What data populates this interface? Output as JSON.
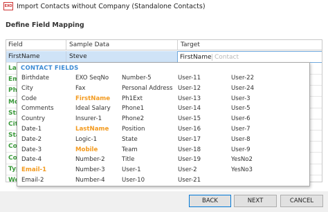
{
  "window": {
    "title": "Import Contacts without Company (Standalone Contacts)",
    "icon_text": "EXO"
  },
  "section_title": "Define Field Mapping",
  "grid": {
    "headers": {
      "field": "Field",
      "sample": "Sample Data",
      "target": "Target"
    },
    "selected_row": {
      "field": "FirstName",
      "sample": "Steve",
      "target": "FirstName",
      "target_placeholder": "Contact"
    },
    "field_rows": [
      "Last",
      "Ema",
      "Pho",
      "Mob",
      "Stre",
      "City",
      "Stat",
      "Cou",
      "Cou",
      "Typ",
      "Wel"
    ]
  },
  "dropdown": {
    "header": "CONTACT FIELDS",
    "columns": [
      [
        "Birthdate",
        "City",
        "Code",
        "Comments",
        "Country",
        "Date-1",
        "Date-2",
        "Date-3",
        "Date-4",
        "Email-1",
        "Email-2"
      ],
      [
        "EXO SeqNo",
        "Fax",
        "FirstName",
        "Ideal Salary",
        "Insurer-1",
        "LastName",
        "Logic-1",
        "Mobile",
        "Number-2",
        "Number-3",
        "Number-4"
      ],
      [
        "Number-5",
        "Personal Address",
        "Ph1Ext",
        "Phone1",
        "Phone2",
        "Position",
        "State",
        "Team",
        "Title",
        "User-1",
        "User-10"
      ],
      [
        "User-11",
        "User-12",
        "User-13",
        "User-14",
        "User-15",
        "User-16",
        "User-17",
        "User-18",
        "User-19",
        "User-2",
        "User-21"
      ],
      [
        "User-22",
        "User-24",
        "User-3",
        "User-5",
        "User-6",
        "User-7",
        "User-8",
        "User-9",
        "YesNo2",
        "YesNo3"
      ]
    ],
    "highlighted": [
      "FirstName",
      "LastName",
      "Mobile",
      "Email-1"
    ]
  },
  "buttons": {
    "back": "BACK",
    "next": "NEXT",
    "cancel": "CANCEL"
  },
  "colors": {
    "accent": "#3b8ad4",
    "highlight": "#f39a1e",
    "mapped": "#3a9a3a",
    "selection": "#cfe3f7"
  }
}
